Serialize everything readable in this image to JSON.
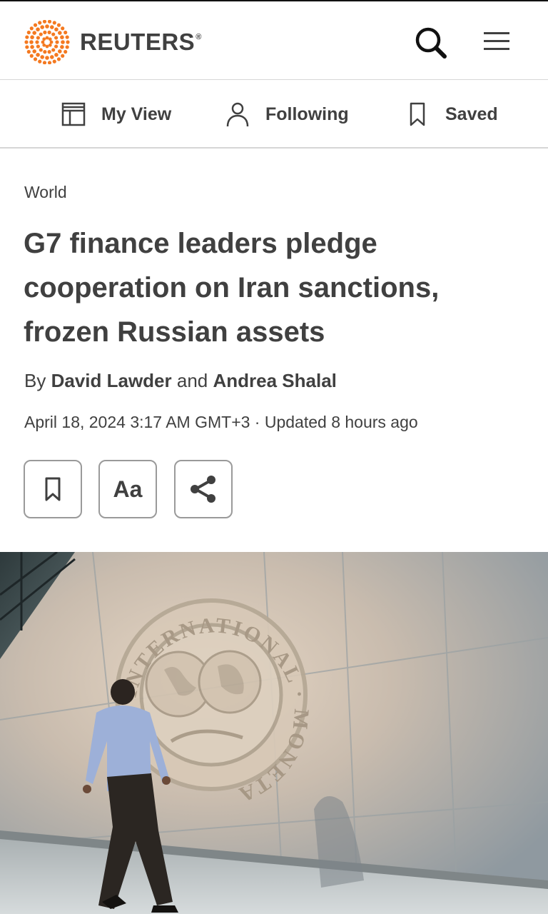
{
  "header": {
    "brand": "REUTERS",
    "brand_mark": "®",
    "icons": {
      "search": "search-icon",
      "menu": "hamburger-menu-icon"
    }
  },
  "subnav": {
    "items": [
      {
        "label": "My View",
        "icon": "layout-icon"
      },
      {
        "label": "Following",
        "icon": "person-icon"
      },
      {
        "label": "Saved",
        "icon": "bookmark-icon"
      }
    ]
  },
  "article": {
    "section": "World",
    "headline": "G7 finance leaders pledge cooperation on Iran sanctions, frozen Russian assets",
    "byline": {
      "prefix": "By",
      "author1": "David Lawder",
      "joiner": "and",
      "author2": "Andrea Shalal"
    },
    "dateline": "April 18, 2024 3:17 AM GMT+3 · Updated 8 hours ago",
    "actions": {
      "save_icon": "bookmark-icon",
      "font_label": "Aa",
      "share_icon": "share-icon"
    },
    "photo": {
      "seal_text": "INTERNATIONAL · MONETARY FUND"
    }
  },
  "colors": {
    "text": "#404040",
    "brand_orange": "#f47920",
    "border": "#d6d6d6"
  }
}
